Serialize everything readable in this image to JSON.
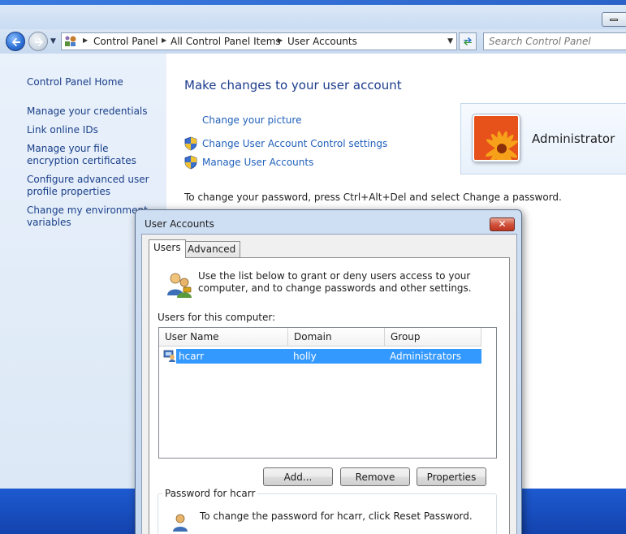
{
  "window": {
    "address": {
      "crumbs": [
        "Control Panel",
        "All Control Panel Items",
        "User Accounts"
      ]
    },
    "search": {
      "placeholder": "Search Control Panel"
    }
  },
  "left_pane": {
    "home_label": "Control Panel Home",
    "links": [
      "Manage your credentials",
      "Link online IDs",
      "Manage your file encryption certificates",
      "Configure advanced user profile properties",
      "Change my environment variables"
    ]
  },
  "main": {
    "title": "Make changes to your user account",
    "tasks": [
      {
        "label": "Change your picture",
        "shield": false
      },
      {
        "label": "Change User Account Control settings",
        "shield": true
      },
      {
        "label": "Manage User Accounts",
        "shield": true
      }
    ],
    "password_note": "To change your password, press Ctrl+Alt+Del and select Change a password.",
    "account": {
      "name": "Administrator",
      "picture_icon": "flower-picture-icon"
    }
  },
  "dialog": {
    "title": "User Accounts",
    "close_label": "✕",
    "tabs": [
      "Users",
      "Advanced"
    ],
    "active_tab": "Users",
    "intro": "Use the list below to grant or deny users access to your computer, and to change passwords and other settings.",
    "list_label": "Users for this computer:",
    "columns": [
      "User Name",
      "Domain",
      "Group"
    ],
    "rows": [
      {
        "user": "hcarr",
        "domain": "holly",
        "group": "Administrators",
        "selected": true
      }
    ],
    "buttons": {
      "add": "Add...",
      "remove": "Remove",
      "properties": "Properties"
    },
    "password_group": {
      "legend": "Password for hcarr",
      "text": "To change the password for hcarr, click Reset Password."
    }
  },
  "colors": {
    "link": "#1f5fba",
    "title": "#1c3b8c",
    "selection": "#3399ff",
    "close_button": "#c8402a"
  }
}
